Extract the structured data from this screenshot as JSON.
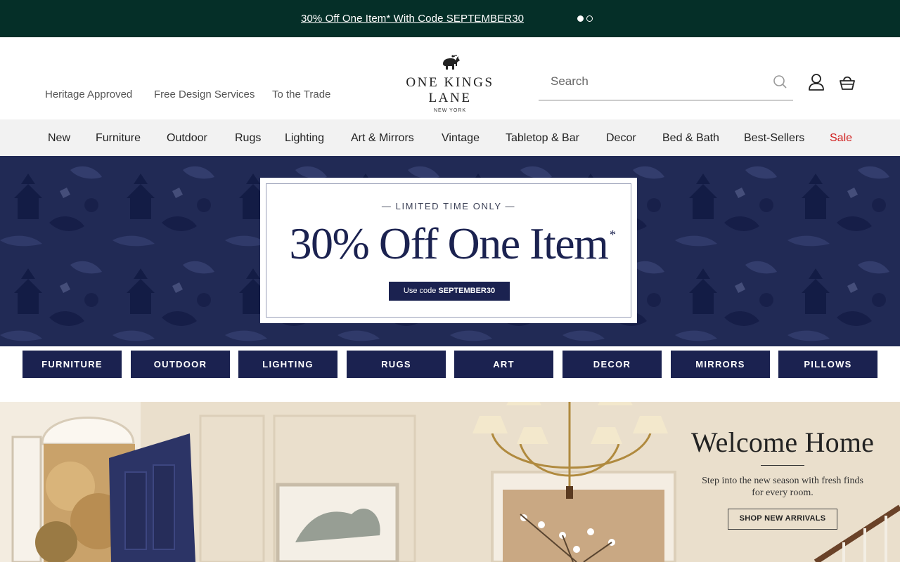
{
  "promo": {
    "text": "30% Off One Item* With Code SEPTEMBER30",
    "slides": 2,
    "active_slide": 1
  },
  "header": {
    "utility_links": [
      "Heritage Approved",
      "Free Design Services",
      "To the Trade"
    ],
    "logo": {
      "name": "ONE KINGS LANE",
      "subtitle": "NEW YORK"
    },
    "search": {
      "placeholder": "Search",
      "value": ""
    }
  },
  "nav": {
    "items": [
      "New",
      "Furniture",
      "Outdoor",
      "Rugs",
      "Lighting",
      "Art & Mirrors",
      "Vintage",
      "Tabletop & Bar",
      "Decor",
      "Bed & Bath",
      "Best-Sellers",
      "Sale"
    ]
  },
  "hero": {
    "kicker": "— LIMITED TIME ONLY —",
    "title": "30% Off One Item",
    "asterisk": "*",
    "code_prefix": "Use code ",
    "code": "SEPTEMBER30"
  },
  "categories": [
    "FURNITURE",
    "OUTDOOR",
    "LIGHTING",
    "RUGS",
    "ART",
    "DECOR",
    "MIRRORS",
    "PILLOWS"
  ],
  "banner": {
    "title": "Welcome Home",
    "text": "Step into the new season with fresh finds for every room.",
    "button": "SHOP NEW ARRIVALS"
  },
  "colors": {
    "promo_bg": "#052f28",
    "navy": "#1b2250",
    "nav_bg": "#f2f2f2",
    "sale": "#d0201f"
  },
  "icons": [
    "search-icon",
    "account-icon",
    "cart-icon",
    "elephant-logo-icon"
  ]
}
